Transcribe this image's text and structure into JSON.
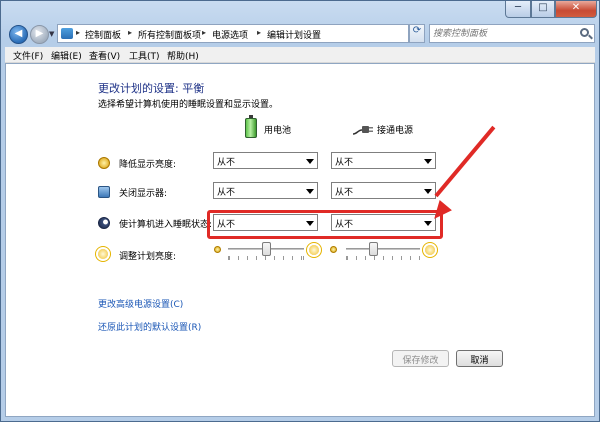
{
  "window": {
    "controls": {
      "minimize": "─",
      "maximize": "□",
      "close": "✕"
    }
  },
  "nav": {
    "back": "◀",
    "forward": "▶"
  },
  "address": {
    "crumbs": [
      "控制面板",
      "所有控制面板项",
      "电源选项",
      "编辑计划设置"
    ],
    "separator": "▸"
  },
  "search": {
    "placeholder": "搜索控制面板"
  },
  "menu": [
    "文件(F)",
    "编辑(E)",
    "查看(V)",
    "工具(T)",
    "帮助(H)"
  ],
  "page": {
    "title": "更改计划的设置: 平衡",
    "subtitle": "选择希望计算机使用的睡眠设置和显示设置。"
  },
  "columns": {
    "battery": "用电池",
    "plugged": "接通电源"
  },
  "rows": [
    {
      "label": "降低显示亮度:",
      "battery": "从不",
      "plugged": "从不"
    },
    {
      "label": "关闭显示器:",
      "battery": "从不",
      "plugged": "从不"
    },
    {
      "label": "使计算机进入睡眠状态:",
      "battery": "从不",
      "plugged": "从不"
    }
  ],
  "brightness": {
    "label": "调整计划亮度:",
    "battery_level": 0.5,
    "plugged_level": 0.37
  },
  "links": {
    "advanced": "更改高级电源设置(C)",
    "restore": "还原此计划的默认设置(R)"
  },
  "buttons": {
    "save": "保存修改",
    "cancel": "取消"
  },
  "colors": {
    "highlight": "#e02a26",
    "title": "#1e3287",
    "link": "#1b57b6"
  }
}
